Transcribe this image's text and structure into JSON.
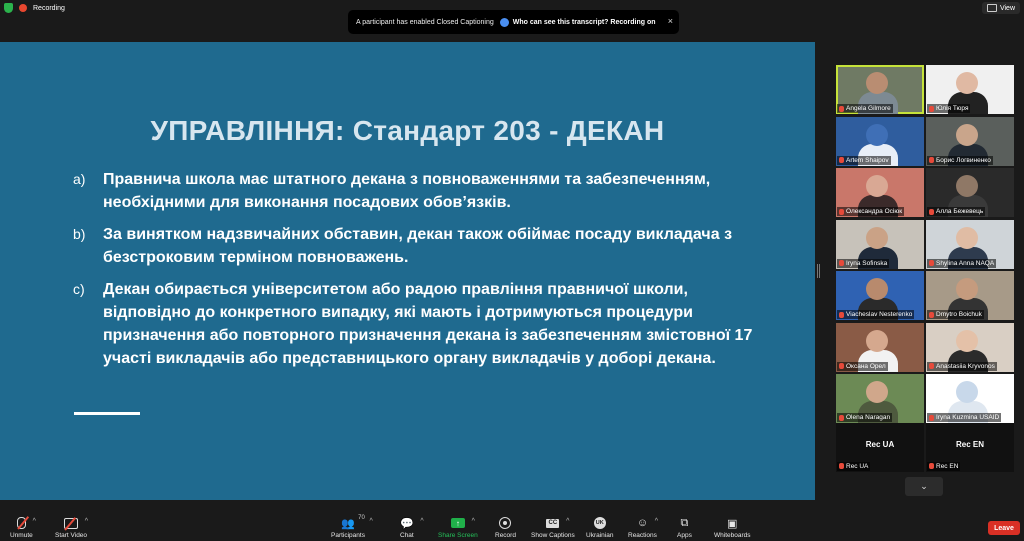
{
  "topbar": {
    "recording_label": "Recording",
    "view_label": "View"
  },
  "notification": {
    "text": "A participant has enabled Closed Captioning",
    "link": "Who can see this transcript? Recording on",
    "close": "×"
  },
  "slide": {
    "title": "УПРАВЛІННЯ: Стандарт 203 - ДЕКАН",
    "items": [
      {
        "letter": "a)",
        "text": "Правнича школа має штатного декана з повноваженнями та забезпеченням, необхідними для виконання посадових обов’язків."
      },
      {
        "letter": "b)",
        "text": "За винятком надзвичайних обставин, декан також обіймає посаду викладача з безстроковим терміном повноважень."
      },
      {
        "letter": "c)",
        "text": "Декан обирається університетом або радою правління правничої школи, відповідно до конкретного випадку, які мають і дотримуються процедури призначення або повторного призначення декана із забезпеченням змістовної 17 участі викладачів або представницького органу викладачів у доборі декана."
      }
    ]
  },
  "gallery": {
    "tiles": [
      {
        "name": "Angela Gilmore",
        "bg": "#6f7a64",
        "skin": "#b98d72",
        "shirt": "#7d8a93"
      },
      {
        "name": "Юлія Тюря",
        "bg": "#f0f0f0",
        "skin": "#e0b9a3",
        "shirt": "#222222"
      },
      {
        "name": "Artem Shaipov",
        "bg": "#2f5d9e",
        "skin": "#3f6fb6",
        "shirt": "#e8eef7"
      },
      {
        "name": "Борис Логвиненко",
        "bg": "#5a5f5c",
        "skin": "#c9a58b",
        "shirt": "#222a33"
      },
      {
        "name": "Олександра Осіюк",
        "bg": "#c9776a",
        "skin": "#d9a894",
        "shirt": "#3b2a2a"
      },
      {
        "name": "Алла Бежевець",
        "bg": "#2a2a2a",
        "skin": "#8f7866",
        "shirt": "#3a3a3a"
      },
      {
        "name": "Iryna Sofinska",
        "bg": "#c7c2ba",
        "skin": "#caa286",
        "shirt": "#1f2a3a"
      },
      {
        "name": "Shylina Anna NAQA",
        "bg": "#cfd4d8",
        "skin": "#e0bca4",
        "shirt": "#2e3b4e"
      },
      {
        "name": "Viacheslav Nesterenko",
        "bg": "#2f62b3",
        "skin": "#b88a6d",
        "shirt": "#2a2a2a"
      },
      {
        "name": "Dmytro Boichuk",
        "bg": "#a79a88",
        "skin": "#c59b7e",
        "shirt": "#333333"
      },
      {
        "name": "Оксана Орел",
        "bg": "#8a5b46",
        "skin": "#d5a88e",
        "shirt": "#f2f2f2"
      },
      {
        "name": "Anastasiia Kryvonos",
        "bg": "#d9cfc4",
        "skin": "#e4c1a8",
        "shirt": "#2b2b2b"
      },
      {
        "name": "Olena Naragan",
        "bg": "#6c8a55",
        "skin": "#d0a78b",
        "shirt": "#4e5a3e"
      },
      {
        "name": "Iryna Kuzmina USAID",
        "bg": "#ffffff",
        "skin": "#c8d8ea",
        "shirt": "#dfe7f0"
      }
    ],
    "rec_tiles": [
      {
        "title": "Rec UA",
        "name": "Rec UA"
      },
      {
        "title": "Rec EN",
        "name": "Rec EN"
      }
    ],
    "more_icon": "chevron-down-icon"
  },
  "toolbar": {
    "unmute": "Unmute",
    "start_video": "Start Video",
    "participants": "Participants",
    "participants_count": "70",
    "chat": "Chat",
    "share_screen": "Share Screen",
    "record": "Record",
    "show_captions": "Show Captions",
    "captions_badge": "CC",
    "language": "Ukrainian",
    "language_badge": "UK",
    "reactions": "Reactions",
    "apps": "Apps",
    "whiteboards": "Whiteboards",
    "leave": "Leave"
  },
  "colors": {
    "slide_bg": "#1f6a8f",
    "active_speaker": "#c6e33a",
    "leave": "#d93025",
    "share": "#20b04a"
  }
}
